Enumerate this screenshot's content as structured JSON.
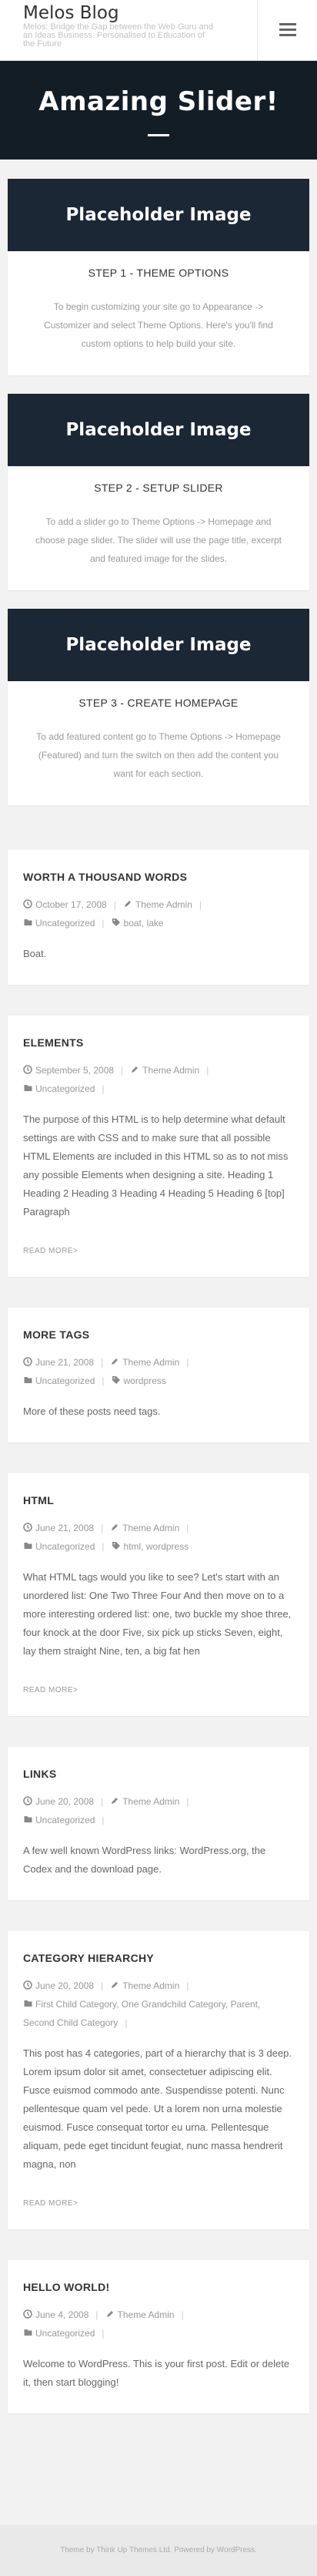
{
  "header": {
    "site_title": "Melos Blog",
    "tagline": "Melos: Bridge the Gap between the Web Guru and an Ideas Business. Personalised to Education of the Future"
  },
  "hero": {
    "title": "Amazing Slider!"
  },
  "slides": [
    {
      "image_label": "Placeholder Image",
      "title": "STEP 1 - THEME OPTIONS",
      "text": "To begin customizing your site go to Appearance -> Customizer and select Theme Options. Here's you'll find custom options to help build your site."
    },
    {
      "image_label": "Placeholder Image",
      "title": "STEP 2 - SETUP SLIDER",
      "text": "To add a slider go to Theme Options -> Homepage and choose page slider. The slider will use the page title, excerpt and featured image for the slides."
    },
    {
      "image_label": "Placeholder Image",
      "title": "STEP 3 - CREATE HOMEPAGE",
      "text": "To add featured content go to Theme Options -> Homepage (Featured) and turn the switch on then add the content you want for each section."
    }
  ],
  "posts": [
    {
      "title": "WORTH A THOUSAND WORDS",
      "date": "October 17, 2008",
      "author": "Theme Admin",
      "categories": "Uncategorized",
      "tags": "boat, lake",
      "excerpt": "Boat.",
      "read_more": ""
    },
    {
      "title": "ELEMENTS",
      "date": "September 5, 2008",
      "author": "Theme Admin",
      "categories": "Uncategorized",
      "tags": "",
      "excerpt": "The purpose of this HTML is to help determine what default settings are with CSS and to make sure that all possible HTML Elements are included in this HTML so as to not miss any possible Elements when designing a site. Heading 1 Heading 2 Heading 3 Heading 4 Heading 5 Heading 6 [top] Paragraph",
      "read_more": "READ MORE>"
    },
    {
      "title": "MORE TAGS",
      "date": "June 21, 2008",
      "author": "Theme Admin",
      "categories": "Uncategorized",
      "tags": "wordpress",
      "excerpt": "More of these posts need tags.",
      "read_more": ""
    },
    {
      "title": "HTML",
      "date": "June 21, 2008",
      "author": "Theme Admin",
      "categories": "Uncategorized",
      "tags": "html, wordpress",
      "excerpt": "What HTML tags would you like to see? Let's start with an unordered list: One Two Three Four And then move on to a more interesting ordered list: one, two buckle my shoe three, four knock at the door Five, six pick up sticks Seven, eight, lay them straight Nine, ten, a big fat hen",
      "read_more": "READ MORE>"
    },
    {
      "title": "LINKS",
      "date": "June 20, 2008",
      "author": "Theme Admin",
      "categories": "Uncategorized",
      "tags": "",
      "excerpt": "A few well known WordPress links: WordPress.org, the Codex and the download page.",
      "read_more": ""
    },
    {
      "title": "CATEGORY HIERARCHY",
      "date": "June 20, 2008",
      "author": "Theme Admin",
      "categories": "First Child Category, One Grandchild Category, Parent, Second Child Category",
      "tags": "",
      "excerpt": "This post has 4 categories, part of a hierarchy that is 3 deep. Lorem ipsum dolor sit amet, consectetuer adipiscing elit. Fusce euismod commodo ante. Suspendisse potenti. Nunc pellentesque quam vel pede. Ut a lorem non urna molestie euismod. Fusce consequat tortor eu urna. Pellentesque aliquam, pede eget tincidunt feugiat, nunc massa hendrerit magna, non",
      "read_more": "READ MORE>"
    },
    {
      "title": "HELLO WORLD!",
      "date": "June 4, 2008",
      "author": "Theme Admin",
      "categories": "Uncategorized",
      "tags": "",
      "excerpt": "Welcome to WordPress. This is your first post. Edit or delete it, then start blogging!",
      "read_more": ""
    }
  ],
  "footer": {
    "text": "Theme by Think Up Themes Ltd. Powered by WordPress."
  },
  "icons": {
    "date": "clock-icon",
    "author": "pencil-icon",
    "categories": "folder-icon",
    "tags": "tag-icon",
    "menu": "hamburger-menu-icon"
  },
  "colors": {
    "hero_bg": "#131d26",
    "slide_image_bg": "#1b2734",
    "page_bg": "#f2f2f2"
  }
}
